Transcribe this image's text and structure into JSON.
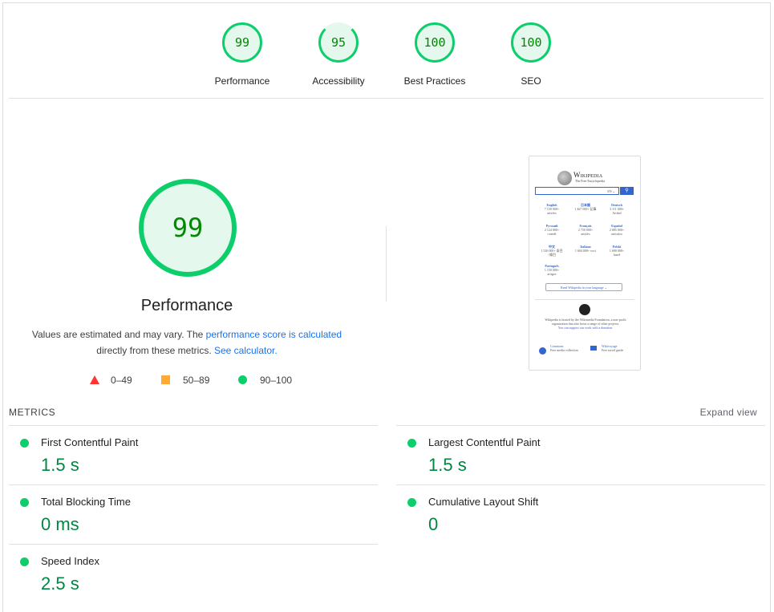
{
  "gauges": [
    {
      "score": "99",
      "label": "Performance",
      "fraction": 0.99
    },
    {
      "score": "95",
      "label": "Accessibility",
      "fraction": 0.95
    },
    {
      "score": "100",
      "label": "Best Practices",
      "fraction": 1.0
    },
    {
      "score": "100",
      "label": "SEO",
      "fraction": 1.0
    }
  ],
  "main": {
    "score": "99",
    "title": "Performance",
    "desc_pre": "Values are estimated and may vary. The ",
    "desc_link1": "performance score is calculated",
    "desc_mid": "directly from these metrics. ",
    "desc_link2": "See calculator.",
    "legend": {
      "low": "0–49",
      "mid": "50–89",
      "high": "90–100"
    }
  },
  "thumbnail": {
    "title": "Wikipedia",
    "subtitle": "The Free Encyclopedia",
    "search_lang": "EN ⌄",
    "languages": [
      {
        "name": "English",
        "count": "7 150 000+",
        "unit": "articles"
      },
      {
        "name": "日本語",
        "count": "1 467 000+ 記事",
        "unit": ""
      },
      {
        "name": "Deutsch",
        "count": "3 111 000+",
        "unit": "Artikel"
      },
      {
        "name": "Русский",
        "count": "2 124 000+",
        "unit": "статей"
      },
      {
        "name": "Français",
        "count": "2 750 000+",
        "unit": "articles"
      },
      {
        "name": "Español",
        "count": "2 085 000+",
        "unit": "artículos"
      },
      {
        "name": "中文",
        "count": "1 526 000+ 条目",
        "unit": "/ 條目"
      },
      {
        "name": "Italiano",
        "count": "1 604 000+ voci",
        "unit": ""
      },
      {
        "name": "Polski",
        "count": "1 690 000+",
        "unit": "haseł"
      },
      {
        "name": "Português",
        "count": "1 150 000+",
        "unit": "artigos"
      }
    ],
    "read_button": "Read Wikipedia in your language ⌄",
    "footer_text": "Wikipedia is hosted by the Wikimedia Foundation, a non-profit organization that also hosts a range of other projects.",
    "footer_link": "You can support our work with a donation.",
    "project1_name": "Commons",
    "project1_desc": "Free media collection",
    "project2_name": "Wikivoyage",
    "project2_desc": "Free travel guide"
  },
  "metrics": {
    "heading": "METRICS",
    "expand_label": "Expand view",
    "left": [
      {
        "name": "First Contentful Paint",
        "value": "1.5 s"
      },
      {
        "name": "Total Blocking Time",
        "value": "0 ms"
      },
      {
        "name": "Speed Index",
        "value": "2.5 s"
      }
    ],
    "right": [
      {
        "name": "Largest Contentful Paint",
        "value": "1.5 s"
      },
      {
        "name": "Cumulative Layout Shift",
        "value": "0"
      }
    ]
  },
  "colors": {
    "pass": "#0cce6b",
    "pass_text": "#008800",
    "average": "#ffaa33",
    "fail": "#ff3333",
    "link": "#1a73e8"
  }
}
